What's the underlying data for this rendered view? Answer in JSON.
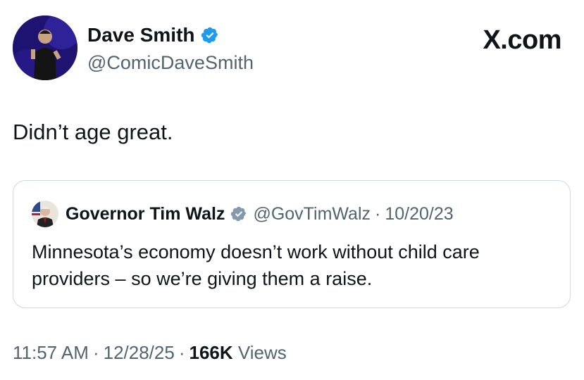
{
  "author": {
    "name": "Dave Smith",
    "handle": "@ComicDaveSmith",
    "verified": true
  },
  "brand": {
    "label": "X.com"
  },
  "tweet": {
    "text": "Didn’t age great."
  },
  "quote": {
    "name": "Governor Tim Walz",
    "handle": "@GovTimWalz",
    "date": "10/20/23",
    "verified_style": "government-gray",
    "text": "Minnesota’s economy doesn’t work without child care providers – so we’re giving them a raise."
  },
  "footer": {
    "time": "11:57 AM",
    "date": "12/28/25",
    "views_count": "166K",
    "views_label": "Views"
  },
  "colors": {
    "verified_blue": "#1d9bf0",
    "gov_badge_gray": "#829aab",
    "secondary_text": "#536471",
    "border": "#cfd9de"
  }
}
